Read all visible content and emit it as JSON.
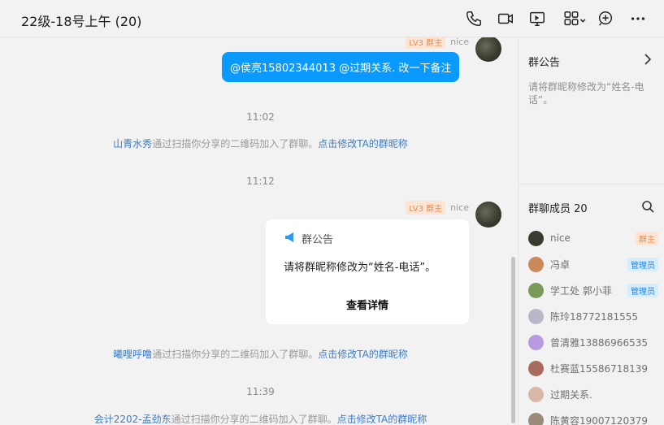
{
  "header": {
    "title": "22级-18号上午 (20)",
    "tools": [
      "phone-icon",
      "video-icon",
      "screen-share-icon",
      "apps-icon",
      "add-icon",
      "more-icon"
    ]
  },
  "chat": {
    "messages": [
      {
        "sender": "nice",
        "level": "LV3 群主",
        "text": "@侯亮15802344013 @过期关系. 改一下备注"
      },
      {
        "sender": "nice",
        "level": "LV3 群主"
      }
    ],
    "times": [
      "11:02",
      "11:12",
      "11:39"
    ],
    "system": [
      {
        "name": "山青水秀",
        "text": "通过扫描你分享的二维码加入了群聊。",
        "link": "点击修改TA的群昵称"
      },
      {
        "name": "曦哩呼噜",
        "text": "通过扫描你分享的二维码加入了群聊。",
        "link": "点击修改TA的群昵称"
      },
      {
        "name": "会计2202-孟劲东",
        "text": "通过扫描你分享的二维码加入了群聊。",
        "link": "点击修改TA的群昵称"
      }
    ],
    "announcement_card": {
      "title": "群公告",
      "body": "请将群昵称修改为“姓名-电话”。",
      "button": "查看详情"
    }
  },
  "sidebar": {
    "notice": {
      "title": "群公告",
      "text": "请将群昵称修改为“姓名-电话”。"
    },
    "members": {
      "title": "群聊成员 20",
      "list": [
        {
          "name": "nice",
          "badge": "群主",
          "badge_type": "owner",
          "color": "#3a3a2e"
        },
        {
          "name": "冯卓",
          "badge": "管理员",
          "badge_type": "admin",
          "color": "#c98a5a"
        },
        {
          "name": "学工处 郭小菲",
          "badge": "管理员",
          "badge_type": "admin",
          "color": "#7a9a5a"
        },
        {
          "name": "陈玲18772181555",
          "badge": "",
          "badge_type": "",
          "color": "#b8b8c8"
        },
        {
          "name": "曾清雅13886966535",
          "badge": "",
          "badge_type": "",
          "color": "#b89ae0"
        },
        {
          "name": "杜赛蓝15586718139",
          "badge": "",
          "badge_type": "",
          "color": "#a86a5a"
        },
        {
          "name": "过期关系.",
          "badge": "",
          "badge_type": "",
          "color": "#d8b8a8"
        },
        {
          "name": "陈黄容19007120379",
          "badge": "",
          "badge_type": "",
          "color": "#9a8a7a"
        }
      ]
    }
  },
  "colors": {
    "accent": "#0a99ff",
    "link": "#3e7cc1",
    "owner_badge": "#f08a4b",
    "admin_badge": "#2b86d8"
  }
}
